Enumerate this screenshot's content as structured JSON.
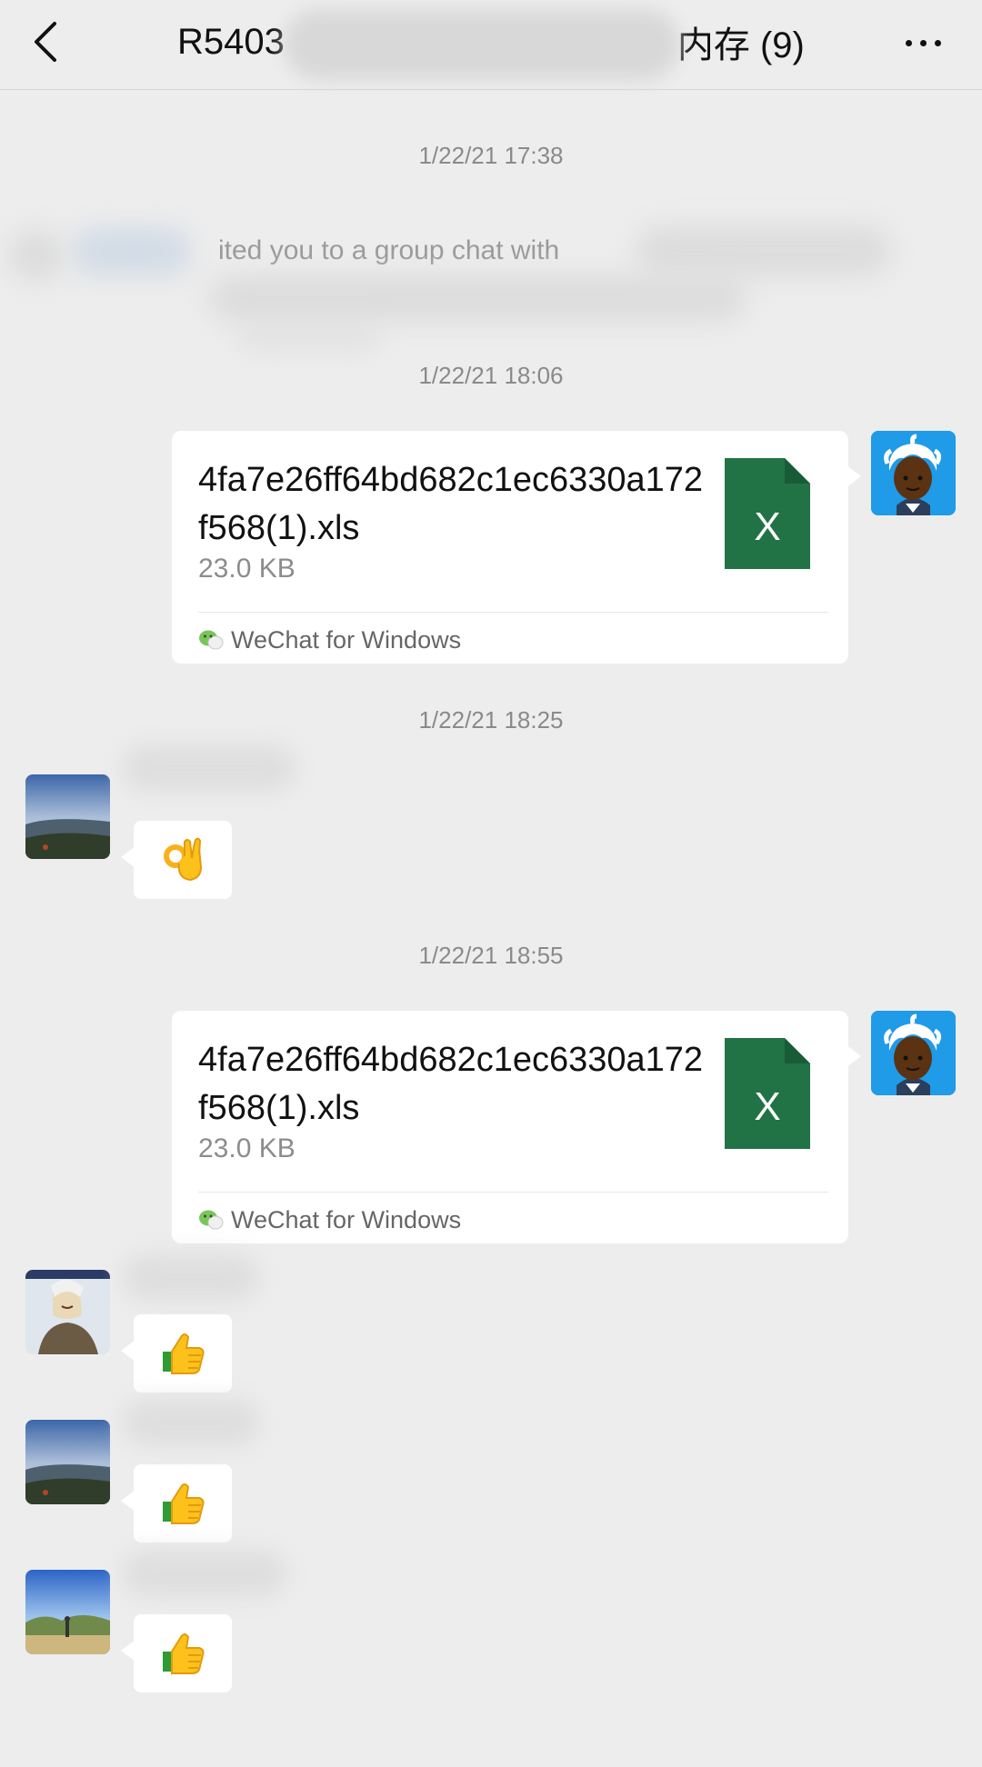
{
  "header": {
    "title_start": "R5403",
    "title_end": "内存 (9)"
  },
  "timestamps": [
    "1/22/21 17:38",
    "1/22/21 18:06",
    "1/22/21 18:25",
    "1/22/21 18:55"
  ],
  "system_message": {
    "text": "ited you to a group chat with"
  },
  "messages": [
    {
      "type": "file",
      "file_name": "4fa7e26ff64bd682c1ec6330a172f568(1).xls",
      "file_size": "23.0 KB",
      "source": "WeChat for Windows",
      "icon_letter": "X"
    },
    {
      "type": "emoji",
      "emoji": "ok-hand-emoji"
    },
    {
      "type": "file",
      "file_name": "4fa7e26ff64bd682c1ec6330a172f568(1).xls",
      "file_size": "23.0 KB",
      "source": "WeChat for Windows",
      "icon_letter": "X"
    },
    {
      "type": "emoji",
      "emoji": "thumbs-up-emoji"
    },
    {
      "type": "emoji",
      "emoji": "thumbs-up-emoji"
    },
    {
      "type": "emoji",
      "emoji": "thumbs-up-emoji"
    }
  ],
  "colors": {
    "background": "#ededed",
    "excel_green": "#217346",
    "avatar_blue": "#1f9be8"
  }
}
